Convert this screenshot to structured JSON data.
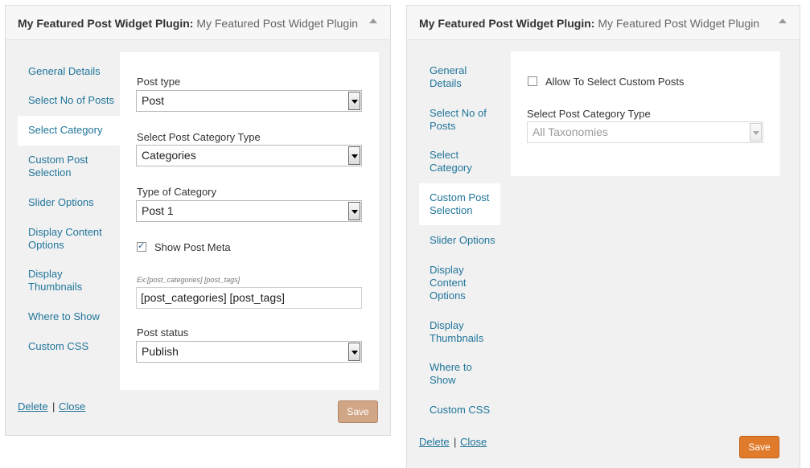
{
  "left_widget": {
    "title_bold": "My Featured Post Widget Plugin:",
    "title_sub": "My Featured Post Widget Plugin",
    "tabs": [
      "General Details",
      "Select No of Posts",
      "Select Category",
      "Custom Post Selection",
      "Slider Options",
      "Display Content Options",
      "Display Thumbnails",
      "Where to Show",
      "Custom CSS"
    ],
    "active_tab": "Select Category",
    "post_type_label": "Post type",
    "post_type_value": "Post",
    "category_type_label": "Select Post Category Type",
    "category_type_value": "Categories",
    "type_of_category_label": "Type of Category",
    "type_of_category_value": "Post 1",
    "show_post_meta_label": "Show Post Meta",
    "show_post_meta_checked": true,
    "meta_hint": "Ex:[post_categories] [post_tags]",
    "meta_value": "[post_categories] [post_tags]",
    "post_status_label": "Post status",
    "post_status_value": "Publish",
    "delete_label": "Delete",
    "separator": "|",
    "close_label": "Close",
    "save_label": "Save"
  },
  "right_widget": {
    "title_bold": "My Featured Post Widget Plugin:",
    "title_sub": "My Featured Post Widget Plugin",
    "tabs": [
      "General Details",
      "Select No of Posts",
      "Select Category",
      "Custom Post Selection",
      "Slider Options",
      "Display Content Options",
      "Display Thumbnails",
      "Where to Show",
      "Custom CSS"
    ],
    "active_tab": "Custom Post Selection",
    "allow_custom_label": "Allow To Select Custom Posts",
    "allow_custom_checked": false,
    "category_type_label": "Select Post Category Type",
    "category_type_value": "All Taxonomies",
    "delete_label": "Delete",
    "separator": "|",
    "close_label": "Close",
    "save_label": "Save"
  },
  "colors": {
    "link": "#21759b",
    "save_disabled": "#d1a687",
    "save_active": "#e07b2c"
  }
}
